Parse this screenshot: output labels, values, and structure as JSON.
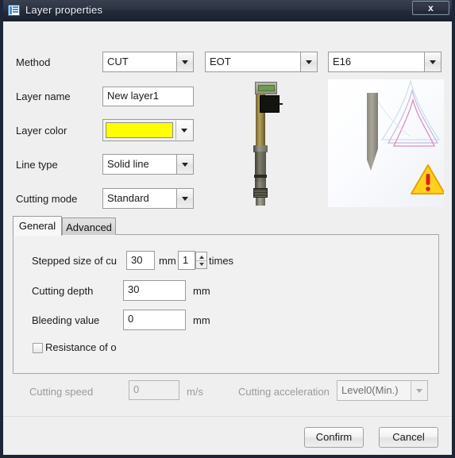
{
  "window": {
    "title": "Layer properties",
    "icon": "layer-list-icon",
    "close_label": "x"
  },
  "form": {
    "method": {
      "label": "Method",
      "cut_value": "CUT",
      "eot_value": "EOT",
      "tool_value": "E16"
    },
    "layer_name": {
      "label": "Layer name",
      "value": "New layer1"
    },
    "layer_color": {
      "label": "Layer color",
      "value": "#FFFF00"
    },
    "line_type": {
      "label": "Line type",
      "value": "Solid line"
    },
    "cutting_mode": {
      "label": "Cutting mode",
      "value": "Standard"
    }
  },
  "preview": {
    "tool_image": "cutting-tool-photo",
    "blade_image": "blade-render",
    "warning_icon": "warning-triangle-icon"
  },
  "tabs": [
    {
      "label": "General",
      "active": true
    },
    {
      "label": "Advanced",
      "active": false
    }
  ],
  "general": {
    "stepped_size": {
      "label": "Stepped size of cu",
      "value": "30",
      "unit": "mm",
      "times_value": "1",
      "times_unit": "times"
    },
    "cutting_depth": {
      "label": "Cutting depth",
      "value": "30",
      "unit": "mm"
    },
    "bleeding_value": {
      "label": "Bleeding value",
      "value": "0",
      "unit": "mm"
    },
    "resistance": {
      "label": "Resistance of o",
      "checked": false
    }
  },
  "footer_settings": {
    "cutting_speed": {
      "label": "Cutting speed",
      "value": "0",
      "unit": "m/s"
    },
    "cutting_acceleration": {
      "label": "Cutting acceleration",
      "value": "Level0(Min.)"
    }
  },
  "buttons": {
    "confirm": "Confirm",
    "cancel": "Cancel"
  },
  "colors": {
    "titlebar": "#2b3342",
    "dialog_bg": "#efefef",
    "accent_yellow": "#FFFF00",
    "warning_yellow": "#FFD21E"
  }
}
